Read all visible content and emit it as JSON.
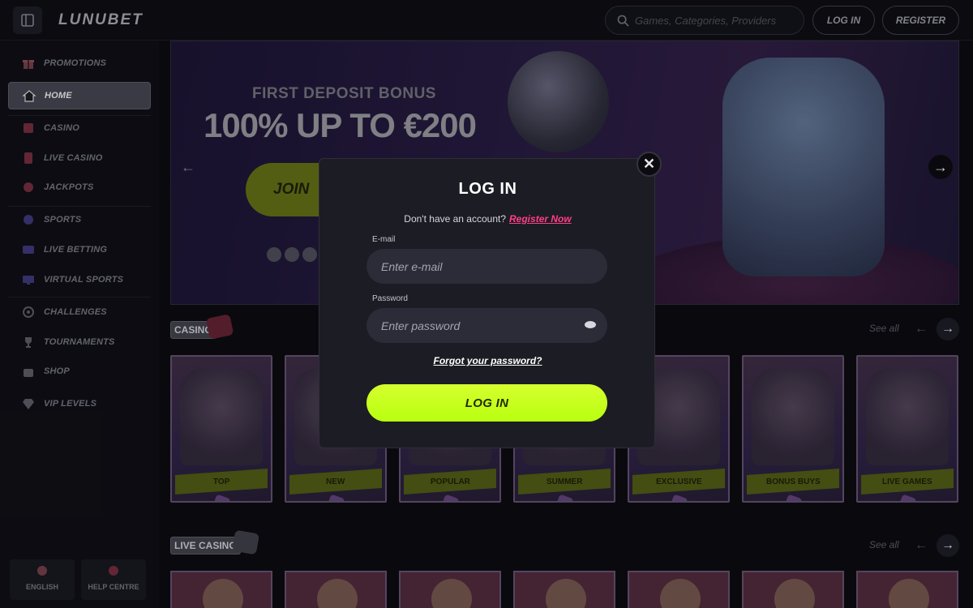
{
  "header": {
    "logo": "LUNUBET",
    "search_placeholder": "Games, Categories, Providers",
    "login_label": "LOG IN",
    "register_label": "REGISTER"
  },
  "sidebar": {
    "items": [
      {
        "label": "PROMOTIONS",
        "icon": "gift-icon"
      },
      {
        "label": "HOME",
        "icon": "home-icon",
        "active": true
      },
      {
        "label": "CASINO",
        "icon": "casino-icon"
      },
      {
        "label": "LIVE CASINO",
        "icon": "cards-icon"
      },
      {
        "label": "JACKPOTS",
        "icon": "jackpot-icon"
      },
      {
        "label": "SPORTS",
        "icon": "ball-icon"
      },
      {
        "label": "LIVE BETTING",
        "icon": "live-icon"
      },
      {
        "label": "VIRTUAL SPORTS",
        "icon": "monitor-icon"
      },
      {
        "label": "CHALLENGES",
        "icon": "target-icon"
      },
      {
        "label": "TOURNAMENTS",
        "icon": "trophy-icon"
      },
      {
        "label": "SHOP",
        "icon": "bag-icon"
      },
      {
        "label": "VIP LEVELS",
        "icon": "diamond-icon"
      }
    ],
    "language_label": "ENGLISH",
    "help_label": "HELP CENTRE"
  },
  "banner": {
    "subtitle": "FIRST DEPOSIT BONUS",
    "title": "100% UP TO €200",
    "join_label": "JOIN"
  },
  "casino_section": {
    "title": "CASINO",
    "see_all": "See all",
    "cards": [
      "TOP",
      "NEW",
      "POPULAR",
      "SUMMER",
      "EXCLUSIVE",
      "BONUS BUYS",
      "LIVE GAMES"
    ]
  },
  "live_casino_section": {
    "title": "LIVE CASINO",
    "see_all": "See all"
  },
  "login_modal": {
    "title": "LOG IN",
    "no_account_text": "Don't have an account?",
    "register_link": "Register Now",
    "email_label": "E-mail",
    "email_placeholder": "Enter e-mail",
    "password_label": "Password",
    "password_placeholder": "Enter password",
    "forgot_link": "Forgot your password?",
    "submit_label": "LOG IN"
  },
  "colors": {
    "accent_lime": "#c8ff1e",
    "link_pink": "#ff3f8a",
    "background": "#0b0b10",
    "modal_bg": "#1c1c24"
  }
}
